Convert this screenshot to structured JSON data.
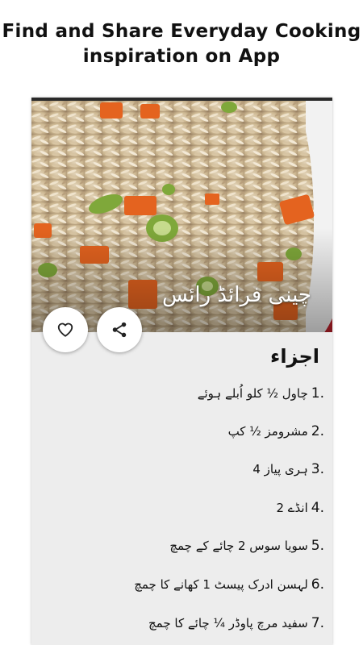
{
  "promo": {
    "line1": "Find and Share Everyday Cooking",
    "line2": "inspiration on App"
  },
  "recipe": {
    "title": "چینی فرائڈ رائس",
    "actions": {
      "like_icon": "heart-outline-icon",
      "share_icon": "share-icon"
    }
  },
  "ingredients": {
    "heading": "اجزاء",
    "items": [
      {
        "num": "1.",
        "text": "چاول ½ کلو اُبلے ہوئے"
      },
      {
        "num": "2.",
        "text": "مشرومز ½ کپ"
      },
      {
        "num": "3.",
        "text": "ہری پیاز 4"
      },
      {
        "num": "4.",
        "text": "انڈے 2"
      },
      {
        "num": "5.",
        "text": "سویا سوس 2 چائے کے چمچ"
      },
      {
        "num": "6.",
        "text": "لہسن ادرک پیسٹ 1 کھانے کا چمچ"
      },
      {
        "num": "7.",
        "text": "سفید مرچ پاوڈر ¼ چائے کا چمچ"
      }
    ]
  }
}
